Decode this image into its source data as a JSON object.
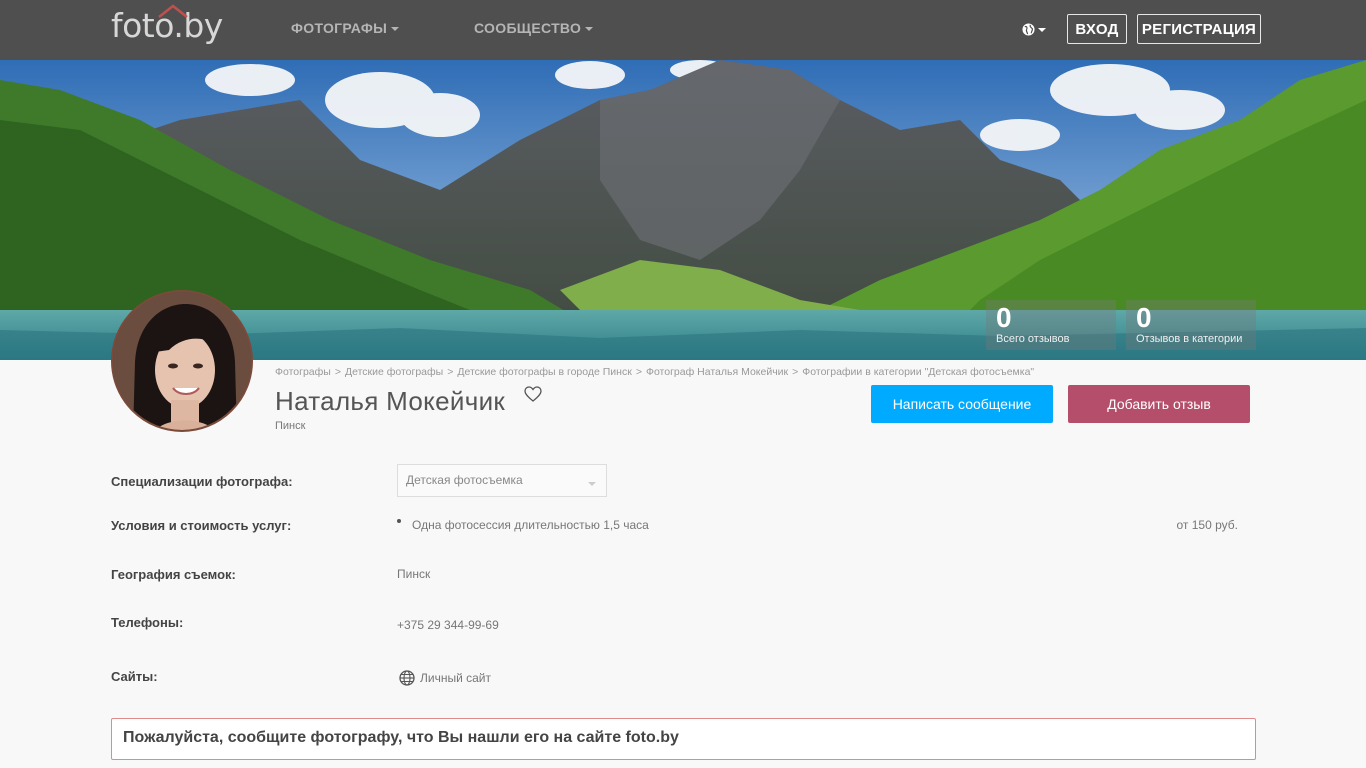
{
  "header": {
    "logo_text": "foto.by",
    "nav": [
      {
        "label": "ФОТОГРАФЫ"
      },
      {
        "label": "СООБЩЕСТВО"
      }
    ],
    "login_label": "ВХОД",
    "register_label": "РЕГИСТРАЦИЯ"
  },
  "stats": [
    {
      "value": "0",
      "label": "Всего отзывов"
    },
    {
      "value": "0",
      "label": "Отзывов в категории"
    }
  ],
  "breadcrumb": [
    "Фотографы",
    "Детские фотографы",
    "Детские фотографы в городе Пинск",
    "Фотограф Наталья Мокейчик",
    "Фотографии в категории \"Детская фотосъемка\""
  ],
  "profile": {
    "name": "Наталья Мокейчик",
    "city": "Пинск",
    "message_button": "Написать сообщение",
    "review_button": "Добавить отзыв"
  },
  "details": {
    "specializations_label": "Специализации фотографа:",
    "specialization_value": "Детская фотосъемка",
    "services_label": "Условия и стоимость услуг:",
    "service_item": "Одна фотосессия длительностью 1,5 часа",
    "service_price": "от 150 руб.",
    "geography_label": "География съемок:",
    "geography_value": "Пинск",
    "phones_label": "Телефоны:",
    "phone_value": "+375 29 344-99-69",
    "sites_label": "Сайты:",
    "site_value": "Личный сайт"
  },
  "notice": "Пожалуйста, сообщите фотографу, что Вы нашли его на сайте foto.by",
  "colors": {
    "topbar": "#4f4f4f",
    "message_button": "#00aaff",
    "review_button": "#b44e6a",
    "notice_border": "#e08a8a"
  }
}
